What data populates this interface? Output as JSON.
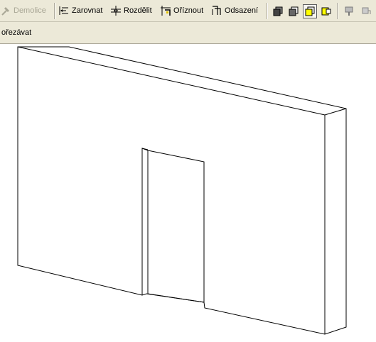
{
  "toolbar": {
    "demolice": "Demolice",
    "zarovnat": "Zarovnat",
    "rozdelit": "Rozdělit",
    "oriznout": "Oříznout",
    "odsazeni": "Odsazení",
    "tools": [
      {
        "icon": "geometry-mode-1-icon"
      },
      {
        "icon": "geometry-mode-2-icon"
      },
      {
        "icon": "geometry-mode-3-icon",
        "active": true
      },
      {
        "icon": "geometry-mode-4-icon"
      },
      {
        "icon": "paint-icon"
      },
      {
        "icon": "paint-format-icon"
      }
    ],
    "colors": {
      "bg": "#ece9d8",
      "highlight": "#ffff00",
      "disabled": "#a9a796"
    }
  },
  "options_bar": {
    "text": "ořezávat"
  },
  "drawing_area": {
    "background": "#ffffff",
    "line_color": "#000000"
  }
}
